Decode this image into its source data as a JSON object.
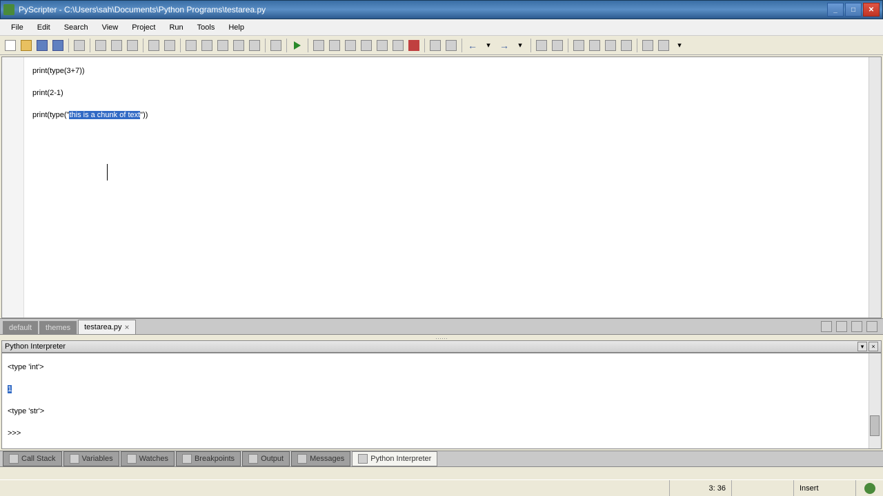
{
  "title": "PyScripter - C:\\Users\\sah\\Documents\\Python Programs\\testarea.py",
  "menu": {
    "file": "File",
    "edit": "Edit",
    "search": "Search",
    "view": "View",
    "project": "Project",
    "run": "Run",
    "tools": "Tools",
    "help": "Help"
  },
  "editor": {
    "line1_a": "print",
    "line1_b": "(",
    "line1_c": "type",
    "line1_d": "(",
    "line1_e": "3+7",
    "line1_f": "))",
    "line2_a": "print",
    "line2_b": "(",
    "line2_c": "2-1",
    "line2_d": ")",
    "line3_a": "print",
    "line3_b": "(",
    "line3_c": "type",
    "line3_d": "(",
    "line3_e": "\"",
    "line3_sel": "this is a chunk of text",
    "line3_f": "\"",
    "line3_g": "))"
  },
  "tabs": {
    "t1": "default",
    "t2": "themes",
    "active": "testarea.py"
  },
  "interpreter_panel": "Python Interpreter",
  "output": {
    "l1": "<type 'int'>",
    "l2": "1",
    "l3": "<type 'str'>",
    "prompt": ">>> "
  },
  "bottom_tabs": {
    "t1": "Call Stack",
    "t2": "Variables",
    "t3": "Watches",
    "t4": "Breakpoints",
    "t5": "Output",
    "t6": "Messages",
    "active": "Python Interpreter"
  },
  "status": {
    "pos": "3: 36",
    "mode": "Insert"
  }
}
